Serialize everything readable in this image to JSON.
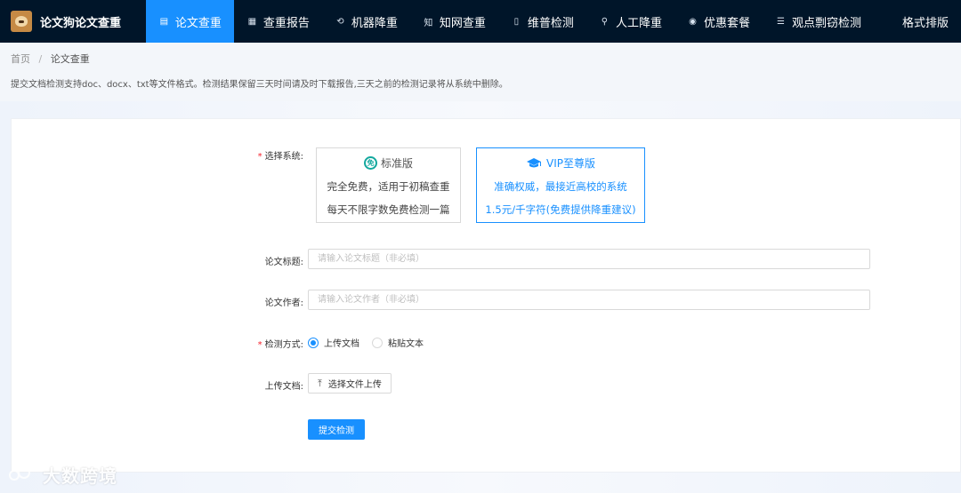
{
  "brand": {
    "name": "论文狗论文查重"
  },
  "nav": [
    {
      "icon": "document-check-icon",
      "glyph": "▤",
      "label": "论文查重",
      "active": true
    },
    {
      "icon": "report-icon",
      "glyph": "▦",
      "label": "查重报告"
    },
    {
      "icon": "robot-icon",
      "glyph": "⟲",
      "label": "机器降重"
    },
    {
      "icon": "zhiwang-icon",
      "glyph": "知",
      "label": "知网查重"
    },
    {
      "icon": "file-icon",
      "glyph": "▯",
      "label": "维普检测"
    },
    {
      "icon": "person-edit-icon",
      "glyph": "⚲",
      "label": "人工降重"
    },
    {
      "icon": "discount-icon",
      "glyph": "◉",
      "label": "优惠套餐"
    },
    {
      "icon": "list-icon",
      "glyph": "☰",
      "label": "观点剽窃检测"
    },
    {
      "icon": "",
      "glyph": "",
      "label": "格式排版"
    }
  ],
  "breadcrumb": {
    "home": "首页",
    "separator": "/",
    "current": "论文查重"
  },
  "notice": "提交文档检测支持doc、docx、txt等文件格式。检测结果保留三天时间请及时下载报告,三天之前的检测记录将从系统中删除。",
  "form": {
    "system_label": "选择系统:",
    "required_mark": "*",
    "cards": {
      "standard": {
        "badge": "免",
        "title": "标准版",
        "line1": "完全免费，适用于初稿查重",
        "line2": "每天不限字数免费检测一篇"
      },
      "vip": {
        "title": "VIP至尊版",
        "line1": "准确权威，最接近高校的系统",
        "line2": "1.5元/千字符(免费提供降重建议)"
      }
    },
    "title_label": "论文标题:",
    "title_placeholder": "请输入论文标题（非必填）",
    "title_value": "",
    "author_label": "论文作者:",
    "author_placeholder": "请输入论文作者（非必填）",
    "author_value": "",
    "method_label": "检测方式:",
    "method_options": [
      {
        "label": "上传文档",
        "checked": true
      },
      {
        "label": "粘贴文本",
        "checked": false
      }
    ],
    "upload_label": "上传文档:",
    "upload_button": "选择文件上传",
    "submit_button": "提交检测"
  },
  "watermark": {
    "text": "大数跨境"
  },
  "colors": {
    "nav_bg": "#001529",
    "accent": "#1890ff",
    "required": "#f5222d",
    "free_badge": "#13a89e"
  }
}
